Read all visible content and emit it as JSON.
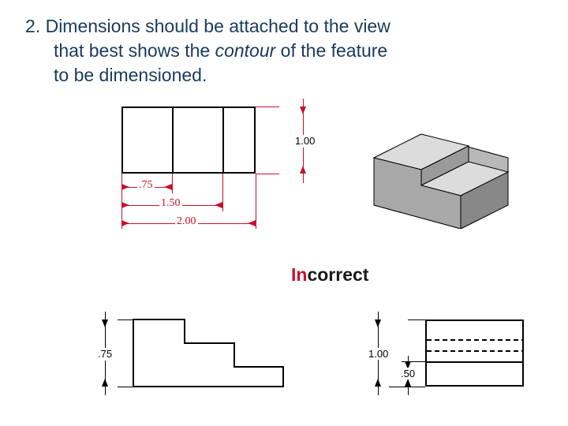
{
  "guideline": {
    "number": "2.",
    "line1": "Dimensions should be attached to the view",
    "line2_a": "that best shows the ",
    "line2_b_italic": "contour",
    "line2_c": " of the feature",
    "line3": "to be dimensioned."
  },
  "labels": {
    "incorrect_prefix": "In",
    "incorrect_rest": "correct"
  },
  "dims_top": {
    "h": "1.00",
    "w_small": ".75",
    "w_mid": "1.50",
    "w_full": "2.00"
  },
  "dims_bottom_left": {
    "h": ".75"
  },
  "dims_bottom_right": {
    "h_full": "1.00",
    "h_step": ".50"
  },
  "chart_data": {
    "type": "table",
    "description": "Engineering drawing dimension values shown in the figure",
    "top_view_dimensions": {
      "height": 1.0,
      "widths": [
        0.75,
        1.5,
        2.0
      ]
    },
    "bottom_left_view_dimensions": {
      "step_height": 0.75
    },
    "bottom_right_view_dimensions": {
      "total_height": 1.0,
      "step_height": 0.5
    }
  }
}
